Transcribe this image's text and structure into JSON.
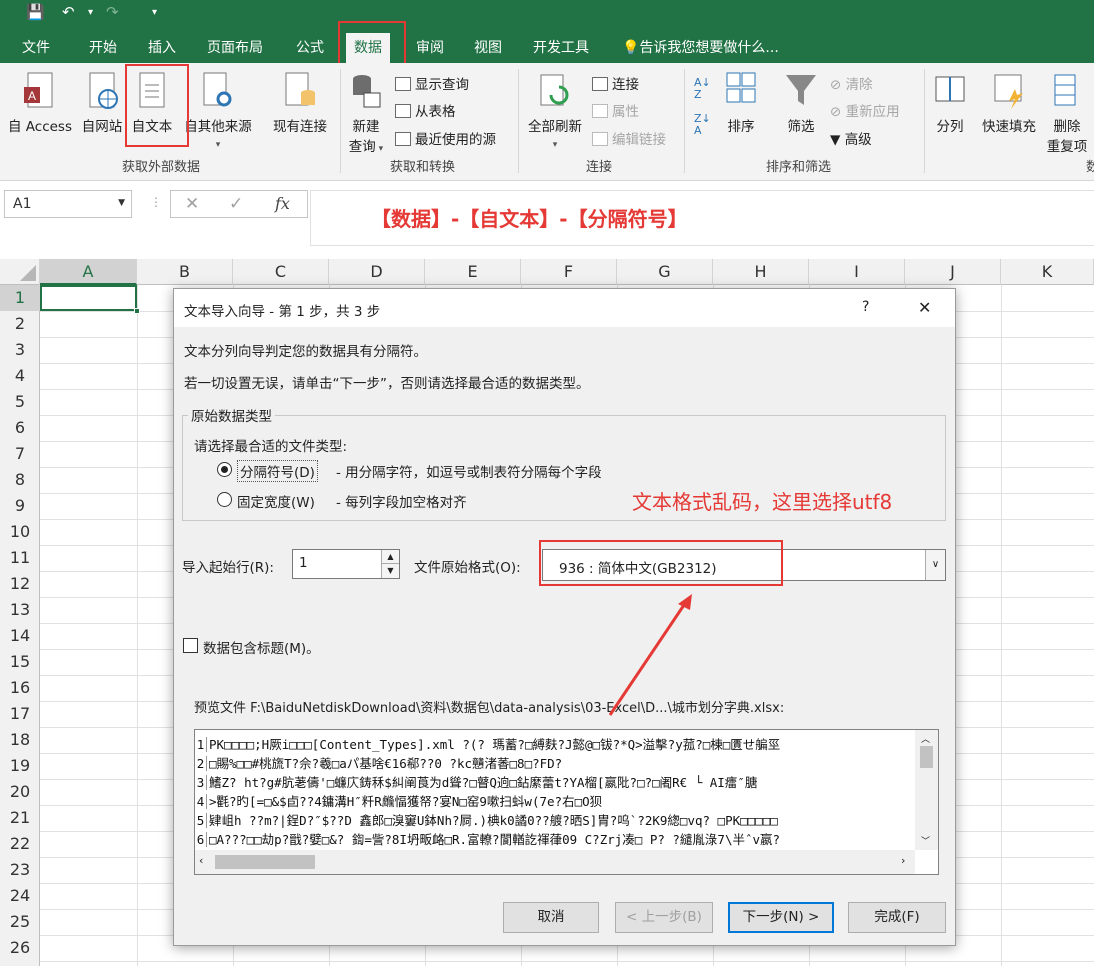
{
  "quick_access": {
    "save": "💾",
    "undo": "↶",
    "redo": "↷",
    "more": "▾"
  },
  "tabs": [
    "文件",
    "开始",
    "插入",
    "页面布局",
    "公式",
    "数据",
    "审阅",
    "视图",
    "开发工具"
  ],
  "tell_me": "告诉我您想要做什么...",
  "ribbon": {
    "get_external": {
      "buttons": [
        "自 Access",
        "自网站",
        "自文本",
        "自其他来源",
        "现有连接"
      ],
      "label": "获取外部数据"
    },
    "get_transform": {
      "new_query": "新建",
      "new_query2": "查询",
      "show_query": "显示查询",
      "from_table": "从表格",
      "recent_sources": "最近使用的源",
      "label": "获取和转换"
    },
    "connections": {
      "refresh_all": "全部刷新",
      "connections": "连接",
      "properties": "属性",
      "edit_links": "编辑链接",
      "label": "连接"
    },
    "sort_filter": {
      "sort": "排序",
      "filter": "筛选",
      "clear": "清除",
      "reapply": "重新应用",
      "advanced": "高级",
      "label": "排序和筛选"
    },
    "data_tools": {
      "text_to_columns": "分列",
      "flash_fill": "快速填充",
      "remove_dup": "删除",
      "remove_dup2": "重复项",
      "label_partial": "数"
    }
  },
  "formula_bar": {
    "name_box": "A1",
    "cancel": "✕",
    "enter": "✓",
    "fx": "fx"
  },
  "annotation_top": "【数据】-【自文本】-【分隔符号】",
  "columns": [
    "A",
    "B",
    "C",
    "D",
    "E",
    "F",
    "G",
    "H",
    "I",
    "J",
    "K"
  ],
  "rows": [
    "1",
    "2",
    "3",
    "4",
    "5",
    "6",
    "7",
    "8",
    "9",
    "10",
    "11",
    "12",
    "13",
    "14",
    "15",
    "16",
    "17",
    "18",
    "19",
    "20",
    "21",
    "22",
    "23",
    "24",
    "25",
    "26"
  ],
  "dialog": {
    "title": "文本导入向导 - 第 1 步，共 3 步",
    "help": "?",
    "close": "✕",
    "line1": "文本分列向导判定您的数据具有分隔符。",
    "line2": "若一切设置无误，请单击“下一步”，否则请选择最合适的数据类型。",
    "group_title": "原始数据类型",
    "choose_prompt": "请选择最合适的文件类型:",
    "opt_delimited": "分隔符号(D)",
    "opt_delimited_desc": "- 用分隔字符，如逗号或制表符分隔每个字段",
    "opt_fixed": "固定宽度(W)",
    "opt_fixed_desc": "- 每列字段加空格对齐",
    "start_row_label": "导入起始行(R):",
    "start_row_value": "1",
    "origin_label": "文件原始格式(O):",
    "origin_value": "936 : 简体中文(GB2312)",
    "header_check": "数据包含标题(M)。",
    "preview_label": "预览文件 F:\\BaiduNetdiskDownload\\资料\\数据包\\data-analysis\\03-Excel\\D...\\城市划分字典.xlsx:",
    "preview_lines": [
      "PK□□□□;H厥i□□□[Content_Types].xml ?(? 瑪蓄?□縛麩?J懿@□钹?*Q>溢擊?y菰?□棟□匱せ艑巠",
      "□賜%□□#桃旒T?佘?羲□aパ基啥€16郗??0  ?kc戇渚萫□8□?FD?",
      "鰭Z?  ht?g#肮荖儔'□蠊庂鋳秝$糾阐莨为d聳?□瞽Q逈□鉆縻蕾t?YA榴[嬴阰?□?□阇R€ └  AI癗″膅",
      ">氍?旳[=□&$卣??4鏞溝H″粁R虪愊獲帑?宴N□窑9嗽扫蚪w(7e?右□O狈",
      "肄岨h  ??m?|鋥D?″$??D  鑫郎□溴窶U鉢Nh?屙.)椣k0譎0??艔?晒S]胄?呜`?2K9緫□vq?  □PK□□□□□",
      "□A???□□劫p?戩?嬖□&?  鍧=訾?8I坍畈衉□R.富轑?閬輶訖禈葎09 C?Zrj凑□ P?  ?繾胤淥7\\半ˆv嬴?"
    ],
    "btn_cancel": "取消",
    "btn_back": "< 上一步(B)",
    "btn_next": "下一步(N) >",
    "btn_finish": "完成(F)"
  },
  "annotation_mid": "文本格式乱码，这里选择utf8",
  "colors": {
    "excel_green": "#217346",
    "annotation_red": "#e53935"
  }
}
